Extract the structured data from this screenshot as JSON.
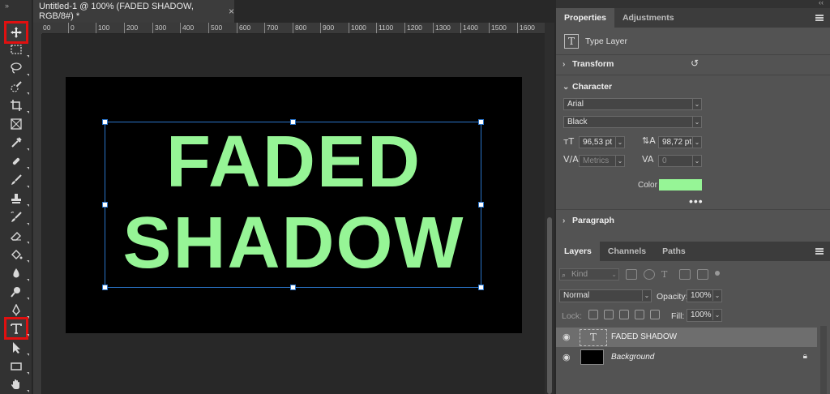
{
  "document": {
    "tab_title": "Untitled-1 @ 100% (FADED SHADOW, RGB/8#) *",
    "close_glyph": "×"
  },
  "ruler": {
    "ticks": [
      "00",
      "0",
      "100",
      "200",
      "300",
      "400",
      "500",
      "600",
      "700",
      "800",
      "900",
      "1000",
      "1100",
      "1200",
      "1300",
      "1400",
      "1500",
      "1600"
    ]
  },
  "canvas": {
    "line1": "FADED",
    "line2": "SHADOW",
    "text_color": "#96f596",
    "background_color": "#000000"
  },
  "toolbar": {
    "tools": [
      {
        "name": "move-tool",
        "highlighted": true
      },
      {
        "name": "marquee-tool"
      },
      {
        "name": "lasso-tool"
      },
      {
        "name": "quick-selection-tool"
      },
      {
        "name": "crop-tool"
      },
      {
        "name": "frame-tool"
      },
      {
        "name": "eyedropper-tool"
      },
      {
        "name": "healing-brush-tool"
      },
      {
        "name": "brush-tool"
      },
      {
        "name": "clone-stamp-tool"
      },
      {
        "name": "history-brush-tool"
      },
      {
        "name": "eraser-tool"
      },
      {
        "name": "paint-bucket-tool"
      },
      {
        "name": "blur-tool"
      },
      {
        "name": "dodge-tool"
      },
      {
        "name": "pen-tool"
      },
      {
        "name": "type-tool",
        "highlighted": true
      },
      {
        "name": "path-selection-tool"
      },
      {
        "name": "rectangle-tool"
      },
      {
        "name": "hand-tool"
      }
    ],
    "highlight_color": "#e01010"
  },
  "properties": {
    "tabs": [
      "Properties",
      "Adjustments"
    ],
    "layer_type": "Type Layer",
    "transform_label": "Transform",
    "character_label": "Character",
    "font_family": "Arial",
    "font_style": "Black",
    "font_size": "96,53 pt",
    "leading": "98,72 pt",
    "kerning": "Metrics",
    "tracking": "0",
    "color_label": "Color",
    "color_value": "#96f596",
    "more_glyph": "•••",
    "paragraph_label": "Paragraph"
  },
  "layers": {
    "tabs": [
      "Layers",
      "Channels",
      "Paths"
    ],
    "kind_placeholder": "Kind",
    "blend_mode": "Normal",
    "opacity_label": "Opacity:",
    "opacity_value": "100%",
    "lock_label": "Lock:",
    "fill_label": "Fill:",
    "fill_value": "100%",
    "items": [
      {
        "name": "FADED SHADOW",
        "type": "text",
        "active": true
      },
      {
        "name": "Background",
        "type": "background",
        "locked": true
      }
    ]
  }
}
